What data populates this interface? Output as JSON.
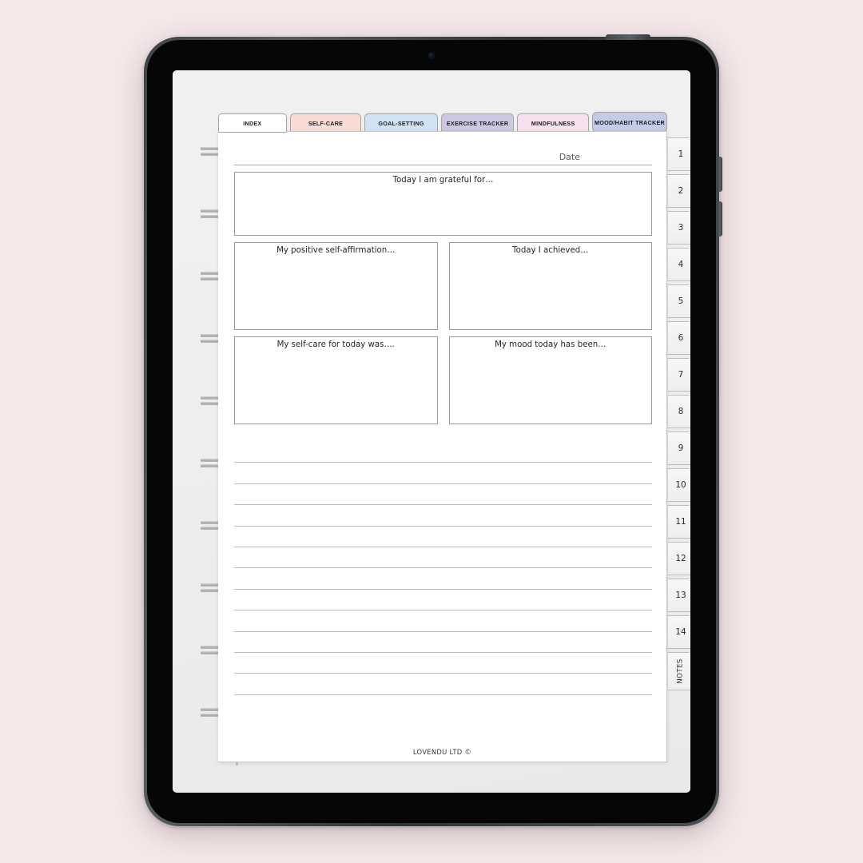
{
  "device": {
    "type": "tablet",
    "camera": "camera-dot",
    "buttons": [
      "power-button",
      "volume-up-button",
      "volume-down-button"
    ]
  },
  "background_color": "#f4e8ea",
  "screen_color": "#eeeeee",
  "planner": {
    "top_tabs": [
      {
        "label": "INDEX",
        "color": "#ffffff",
        "active": true
      },
      {
        "label": "SELF-CARE",
        "color": "#f9dcd6",
        "active": false
      },
      {
        "label": "GOAL-SETTING",
        "color": "#cfe3f4",
        "active": false
      },
      {
        "label": "EXERCISE TRACKER",
        "color": "#ccc8e4",
        "active": false
      },
      {
        "label": "MINDFULNESS",
        "color": "#f8e1ef",
        "active": false
      },
      {
        "label": "MOOD/HABIT  TRACKER",
        "color": "#c3cbe8",
        "active": false
      }
    ],
    "date_label": "Date",
    "prompt_boxes": [
      {
        "title": "Today I am grateful for…",
        "value": ""
      },
      {
        "title": "My positive self-affirmation…",
        "value": ""
      },
      {
        "title": "Today I achieved…",
        "value": ""
      },
      {
        "title": "My self-care for today was….",
        "value": ""
      },
      {
        "title": "My mood today has been…",
        "value": ""
      }
    ],
    "ruled_line_count": 12,
    "footer": "LOVENDU LTD ©",
    "spiral_ring_count": 10,
    "page_tabs": [
      {
        "label": "1"
      },
      {
        "label": "2"
      },
      {
        "label": "3"
      },
      {
        "label": "4"
      },
      {
        "label": "5"
      },
      {
        "label": "6"
      },
      {
        "label": "7"
      },
      {
        "label": "8"
      },
      {
        "label": "9"
      },
      {
        "label": "10"
      },
      {
        "label": "11"
      },
      {
        "label": "12"
      },
      {
        "label": "13"
      },
      {
        "label": "14"
      },
      {
        "label": "NOTES"
      }
    ]
  }
}
